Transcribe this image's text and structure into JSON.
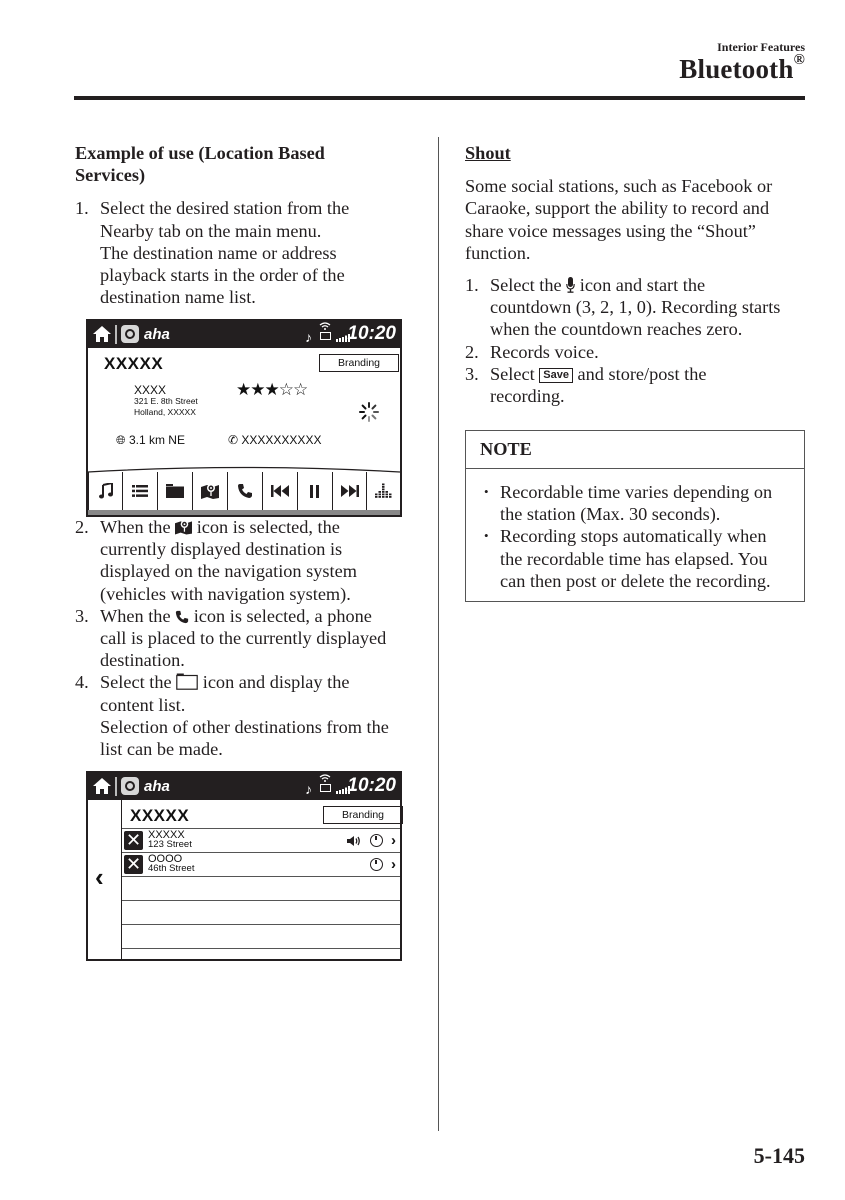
{
  "header": {
    "section": "Interior Features",
    "title": "Bluetooth",
    "title_mark": "®"
  },
  "left": {
    "heading_line1": "Example of use (Location Based",
    "heading_line2": "Services)",
    "step1": {
      "num": "1.",
      "lines": [
        "Select the desired station from the",
        "Nearby tab on the main menu.",
        "The destination name or address",
        "playback starts in the order of the",
        "destination name list."
      ]
    },
    "step2": {
      "num": "2.",
      "pre": "When the",
      "icon": "map-pin-icon",
      "post": "icon is selected, the",
      "lines": [
        "currently displayed destination is",
        "displayed on the navigation system",
        "(vehicles with navigation system)."
      ]
    },
    "step3": {
      "num": "3.",
      "pre": "When the",
      "icon": "phone-icon",
      "post": "icon is selected, a phone",
      "lines": [
        "call is placed to the currently displayed",
        "destination."
      ]
    },
    "step4": {
      "num": "4.",
      "pre": "Select the",
      "icon": "folder-outline-icon",
      "post": "icon and display the",
      "lines": [
        "content list.",
        "Selection of other destinations from the",
        "list can be made."
      ]
    }
  },
  "screen1": {
    "app_name": "aha",
    "time": "10:20",
    "title": "XXXXX",
    "branding": "Branding",
    "detail_name": "XXXX",
    "address1": "321 E. 8th Street",
    "address2": "Holland, XXXXX",
    "rating": 3,
    "rating_max": 5,
    "stars_filled": "★★★",
    "stars_empty": "☆☆",
    "distance": "3.1 km NE",
    "phone": "XXXXXXXXXX",
    "toolbar": [
      "music-note-icon",
      "list-icon",
      "folder-icon",
      "map-pin-icon",
      "phone-icon",
      "previous-track-icon",
      "pause-icon",
      "next-track-icon",
      "equalizer-icon"
    ]
  },
  "screen2": {
    "app_name": "aha",
    "time": "10:20",
    "title": "XXXXX",
    "branding": "Branding",
    "rows": [
      {
        "name": "XXXXX",
        "sub": "123 Street",
        "playing": true
      },
      {
        "name": "OOOO",
        "sub": "46th Street",
        "playing": false
      }
    ],
    "empty_rows": 3
  },
  "right": {
    "heading": "Shout",
    "intro": [
      "Some social stations, such as Facebook or",
      "Caraoke, support the ability to record and",
      "share voice messages using the “Shout”",
      "function."
    ],
    "step1": {
      "num": "1.",
      "pre": "Select the",
      "icon": "microphone-icon",
      "post": "icon and start the",
      "lines": [
        "countdown (3, 2, 1, 0). Recording starts",
        "when the countdown reaches zero."
      ]
    },
    "step2": {
      "num": "2.",
      "text": "Records voice."
    },
    "step3": {
      "num": "3.",
      "pre": "Select",
      "key": "Save",
      "post": "and store/post the",
      "lines": [
        "recording."
      ]
    }
  },
  "note": {
    "title": "NOTE",
    "bullet": "•",
    "items": [
      [
        "Recordable time varies depending on",
        "the station (Max. 30 seconds)."
      ],
      [
        "Recording stops automatically when",
        "the recordable time has elapsed. You",
        "can then post or delete the recording."
      ]
    ]
  },
  "page_number": "5-145"
}
